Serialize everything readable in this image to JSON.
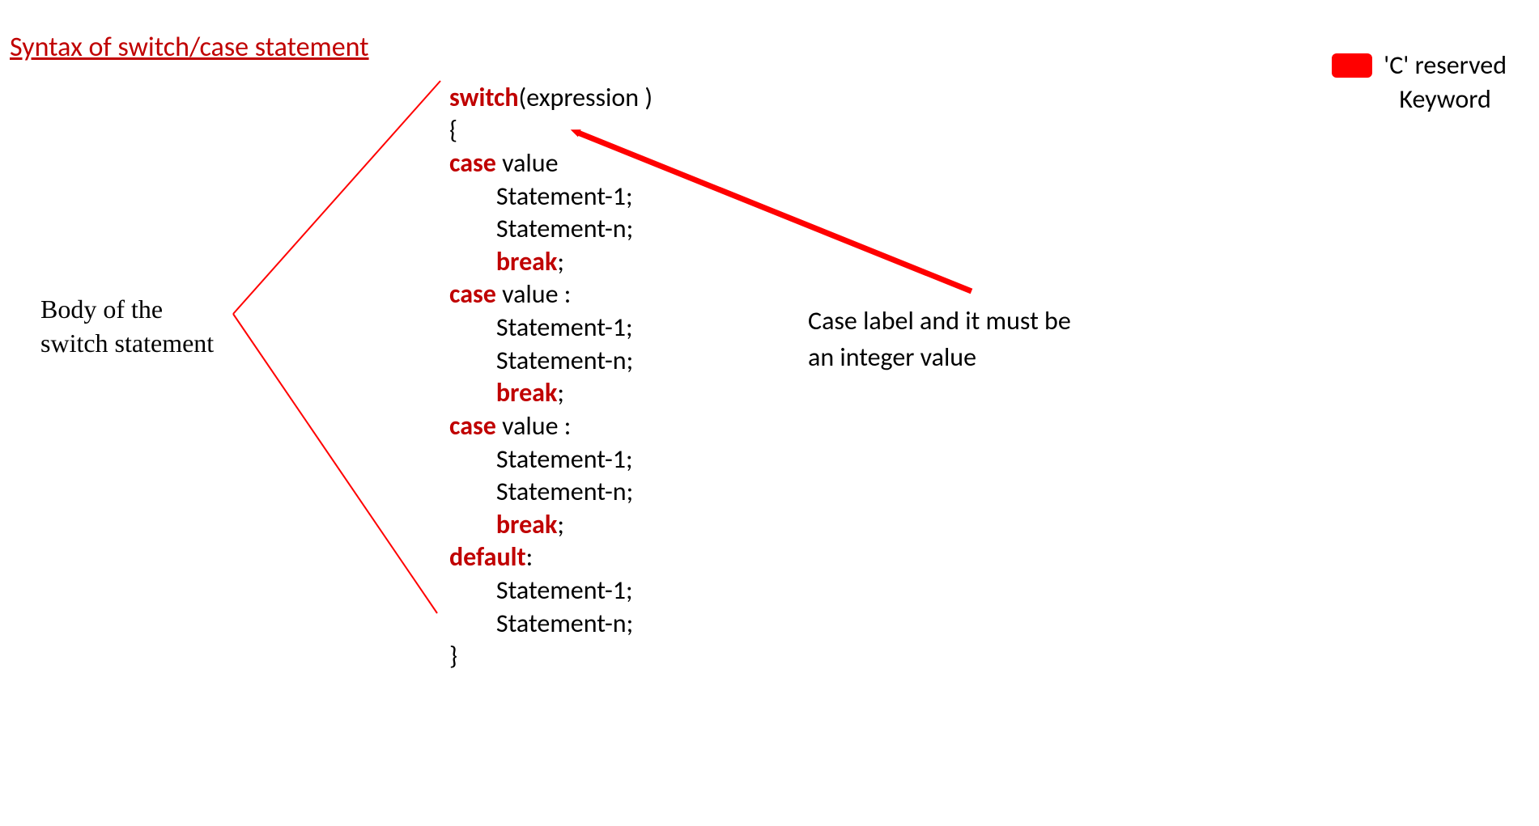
{
  "title": "Syntax of switch/case statement",
  "legend": {
    "color": "#ff0000",
    "text_line1": "'C' reserved",
    "text_line2": "Keyword"
  },
  "annotations": {
    "body_label_line1": "Body of the",
    "body_label_line2": "switch statement",
    "case_label_line1": "Case label and it must be",
    "case_label_line2": "an integer value"
  },
  "code": {
    "switch_kw": "switch",
    "switch_expr": "(expression )",
    "open_brace": "{",
    "case_kw": "case",
    "case1_value": " value",
    "case_value": " value :",
    "stmt1": "Statement-1;",
    "stmtn": "Statement-n;",
    "break_kw": "break",
    "semicolon": ";",
    "default_kw": "default",
    "colon": ":",
    "close_brace": "}"
  }
}
